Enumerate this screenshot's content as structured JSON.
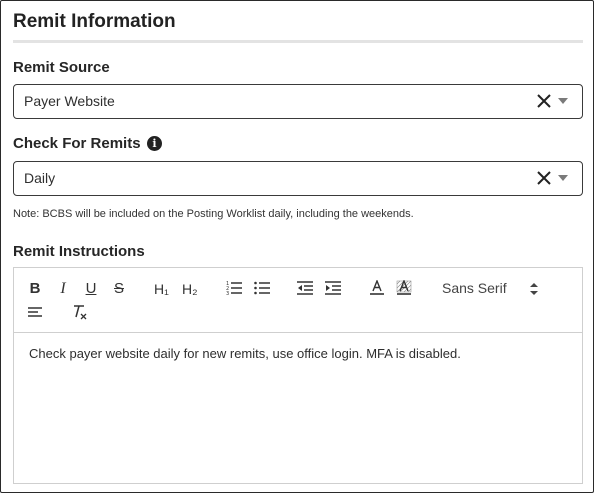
{
  "section": {
    "title": "Remit Information"
  },
  "remit_source": {
    "label": "Remit Source",
    "value": "Payer Website"
  },
  "check_for_remits": {
    "label": "Check For Remits",
    "info_glyph": "i",
    "value": "Daily"
  },
  "note": "Note: BCBS will be included on the Posting Worklist daily, including the weekends.",
  "remit_instructions": {
    "label": "Remit Instructions",
    "toolbar": {
      "bold": "B",
      "italic": "I",
      "underline": "U",
      "strike": "S",
      "h1": "H₁",
      "h2": "H₂",
      "font": "Sans Serif"
    },
    "content": "Check payer website daily for new remits, use office login. MFA is disabled."
  },
  "icons": {
    "clear": "x-icon",
    "dropdown": "chevron-down-icon",
    "info": "info-icon",
    "ordered_list": "ordered-list-icon",
    "bullet_list": "bullet-list-icon",
    "outdent": "outdent-icon",
    "indent": "indent-icon",
    "font_color": "font-color-icon",
    "background": "highlight-icon",
    "align": "align-left-icon",
    "clear_format": "clear-format-icon"
  },
  "colors": {
    "border": "#3a3a3a",
    "divider": "#e3e3e3",
    "editor_border": "#cfcfcf"
  }
}
